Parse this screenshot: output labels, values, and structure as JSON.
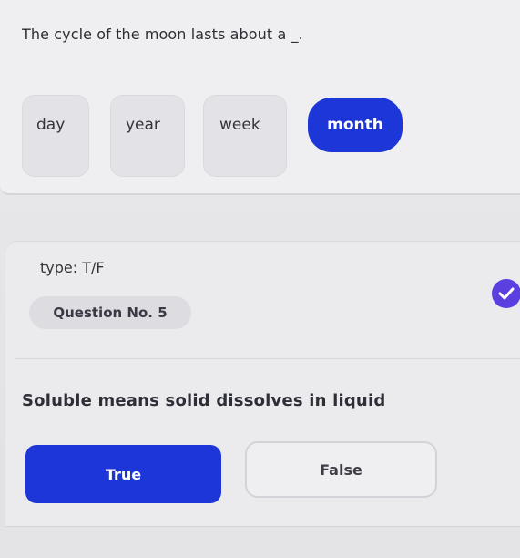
{
  "question4": {
    "text": "The cycle of the moon lasts about a _.",
    "options": [
      {
        "label": "day",
        "selected": false
      },
      {
        "label": "year",
        "selected": false
      },
      {
        "label": "week",
        "selected": false
      },
      {
        "label": "month",
        "selected": true
      }
    ]
  },
  "question5": {
    "type_label": "type: T/F",
    "number_label": "Question No. 5",
    "status_icon": "check-circle-icon",
    "text": "Soluble means solid dissolves in liquid",
    "answers": [
      {
        "label": "True",
        "selected": true
      },
      {
        "label": "False",
        "selected": false
      }
    ]
  },
  "colors": {
    "accent": "#1c36d8",
    "check": "#5b3fe0",
    "option_bg": "#e3e3e7"
  }
}
